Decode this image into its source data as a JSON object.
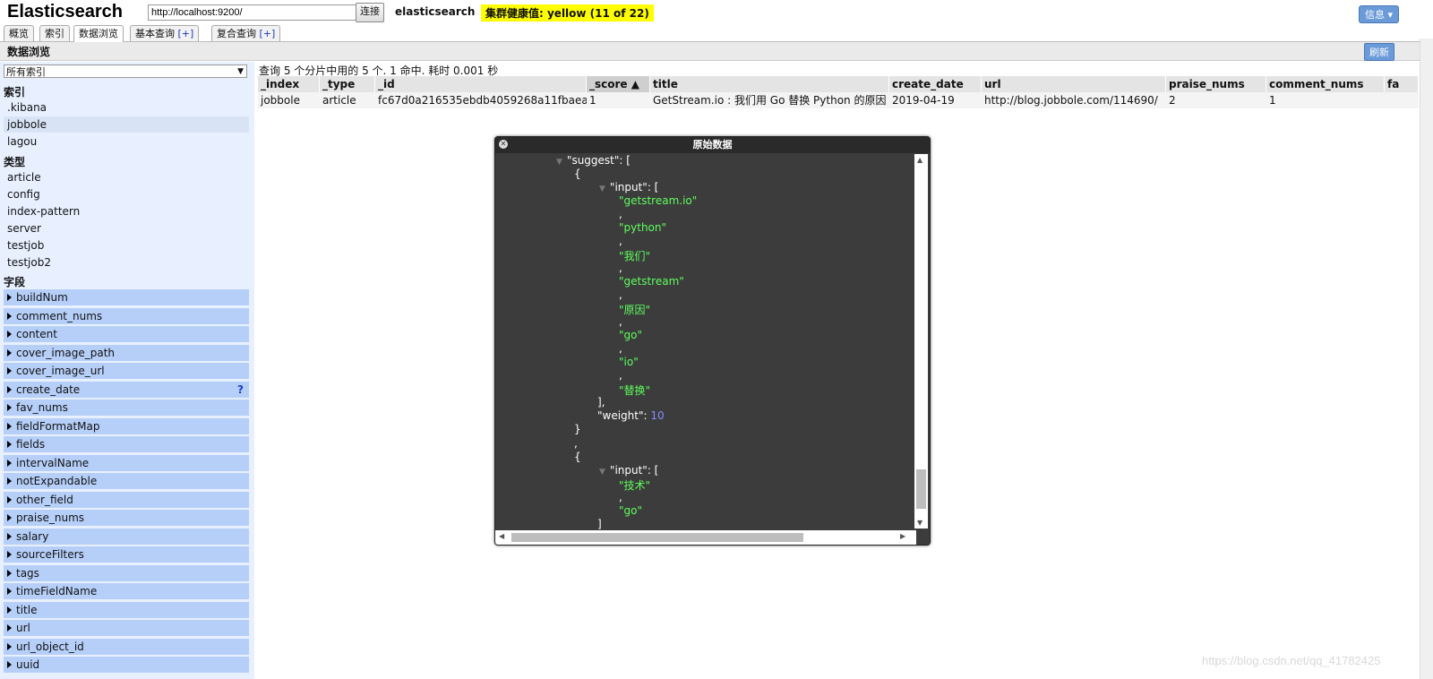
{
  "header": {
    "app_title": "Elasticsearch",
    "url_value": "http://localhost:9200/",
    "connect_label": "连接",
    "cluster_name": "elasticsearch",
    "health_text": "集群健康值: yellow (11 of 22)",
    "info_label": "信息 ▾"
  },
  "tabs": [
    {
      "label": "概览"
    },
    {
      "label": "索引"
    },
    {
      "label": "数据浏览"
    },
    {
      "label": "基本查询",
      "plus": "[+]"
    },
    {
      "label": "复合查询",
      "plus": "[+]"
    }
  ],
  "subbar": {
    "title": "数据浏览",
    "refresh_label": "刷新"
  },
  "sidebar": {
    "index_select": "所有索引",
    "indices_heading": "索引",
    "indices": [
      ".kibana",
      "jobbole",
      "lagou"
    ],
    "types_heading": "类型",
    "types": [
      "article",
      "config",
      "index-pattern",
      "server",
      "testjob",
      "testjob2"
    ],
    "fields_heading": "字段",
    "fields": [
      "buildNum",
      "comment_nums",
      "content",
      "cover_image_path",
      "cover_image_url",
      "create_date",
      "fav_nums",
      "fieldFormatMap",
      "fields",
      "intervalName",
      "notExpandable",
      "other_field",
      "praise_nums",
      "salary",
      "sourceFilters",
      "tags",
      "timeFieldName",
      "title",
      "url",
      "url_object_id",
      "uuid"
    ],
    "help_mark": "?"
  },
  "main": {
    "query_status": "查询 5 个分片中用的 5 个. 1 命中. 耗时 0.001 秒",
    "columns": [
      "_index",
      "_type",
      "_id",
      "_score ▲",
      "title",
      "create_date",
      "url",
      "praise_nums",
      "comment_nums",
      "fa"
    ],
    "row": [
      "jobbole",
      "article",
      "fc67d0a216535ebdb4059268a11fbaea",
      "1",
      "GetStream.io : 我们用 Go 替换 Python 的原因",
      "2019-04-19",
      "http://blog.jobbole.com/114690/",
      "2",
      "1",
      ""
    ]
  },
  "modal": {
    "title": "原始数据",
    "json_lines": {
      "suggest_key": "\"suggest\": [",
      "open_brace": "{",
      "input_key": "\"input\": [",
      "v1": "\"getstream.io\"",
      "comma": ",",
      "v2": "\"python\"",
      "v3": "\"我们\"",
      "v4": "\"getstream\"",
      "v5": "\"原因\"",
      "v6": "\"go\"",
      "v7": "\"io\"",
      "v8": "\"替换\"",
      "close_bracket": "],",
      "weight_key": "\"weight\": ",
      "weight_val": "10",
      "close_brace": "}",
      "comma2": ",",
      "open_brace2": "{",
      "input_key2": "\"input\": [",
      "w1": "\"技术\"",
      "w2": "\"go\"",
      "partial": "]"
    }
  },
  "watermark": "https://blog.csdn.net/qq_41782425"
}
